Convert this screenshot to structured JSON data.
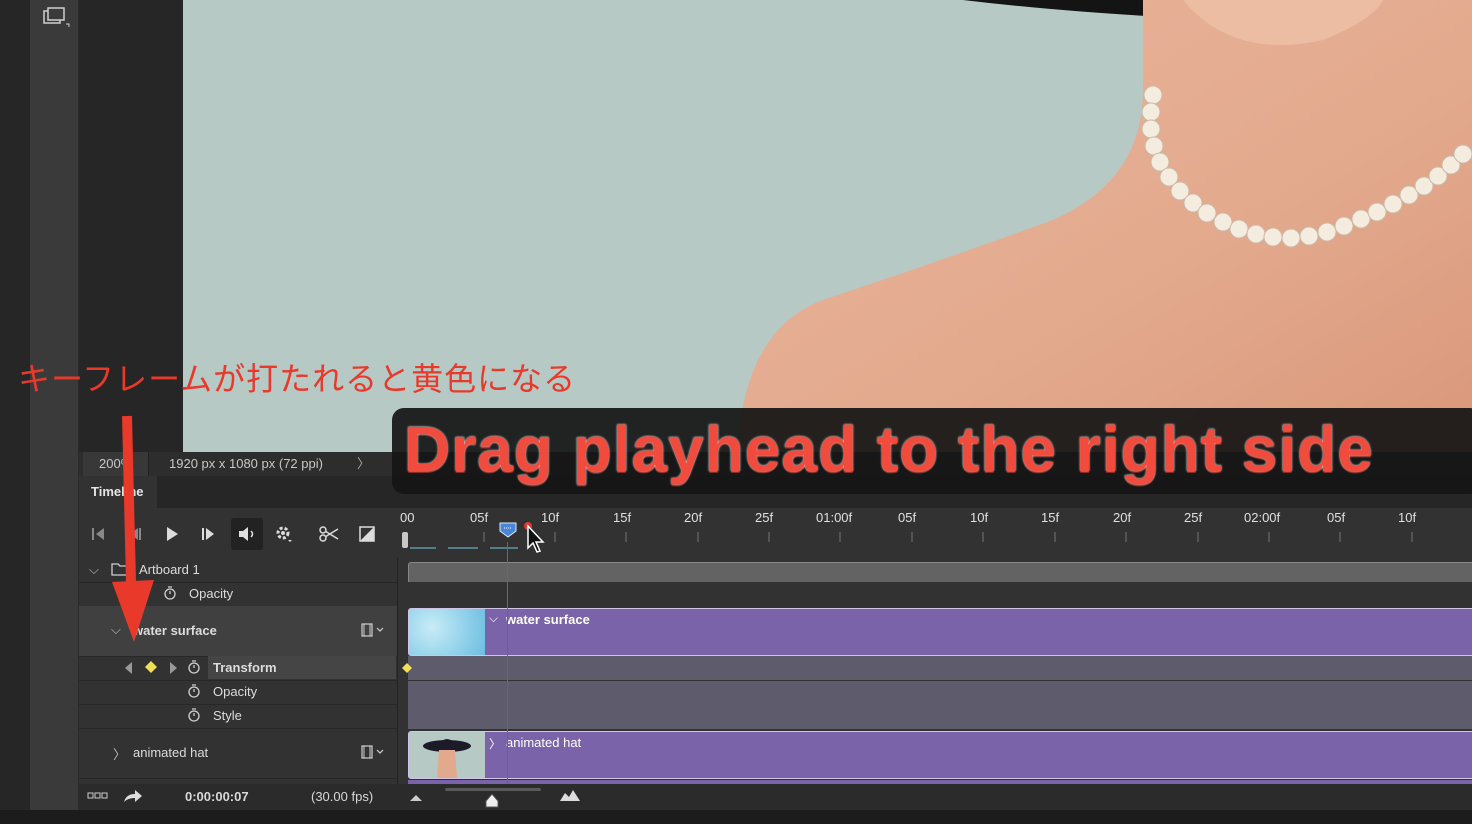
{
  "status_bar": {
    "zoom": "200%",
    "doc_size": "1920 px x 1080 px (72 ppi)",
    "chevron": "〉"
  },
  "timeline": {
    "tab_label": "Timeline",
    "controls": {
      "first_frame_icon": "skip-to-first-frame-icon",
      "prev_frame_icon": "previous-frame-icon",
      "play_icon": "play-icon",
      "next_frame_icon": "next-frame-icon",
      "audio_icon": "speaker-icon",
      "settings_icon": "gear-icon",
      "split_icon": "scissors-icon",
      "transition_icon": "transition-icon"
    },
    "ruler": [
      "00",
      "05f",
      "10f",
      "15f",
      "20f",
      "25f",
      "01:00f",
      "05f",
      "10f",
      "15f",
      "20f",
      "25f",
      "02:00f",
      "05f",
      "10f"
    ],
    "layers": {
      "artboard": "Artboard 1",
      "artboard_opacity": "Opacity",
      "water_surface": "water surface",
      "transform": "Transform",
      "opacity": "Opacity",
      "style": "Style",
      "animated_hat": "animated hat"
    },
    "clips": {
      "water_surface_label": "water surface",
      "animated_hat_label": "animated hat"
    },
    "bottom": {
      "timecode": "0:00:00:07",
      "fps": "(30.00 fps)"
    },
    "current_frame": 7
  },
  "annotations": {
    "japanese_note": "キーフレームが打たれると黄色になる",
    "banner": "Drag  playhead to the right side"
  },
  "colors": {
    "clip_purple": "#7a63a8",
    "keyframe_yellow": "#f1de57",
    "playhead_red": "#d83a2c",
    "annotation_red": "#e8392a"
  }
}
